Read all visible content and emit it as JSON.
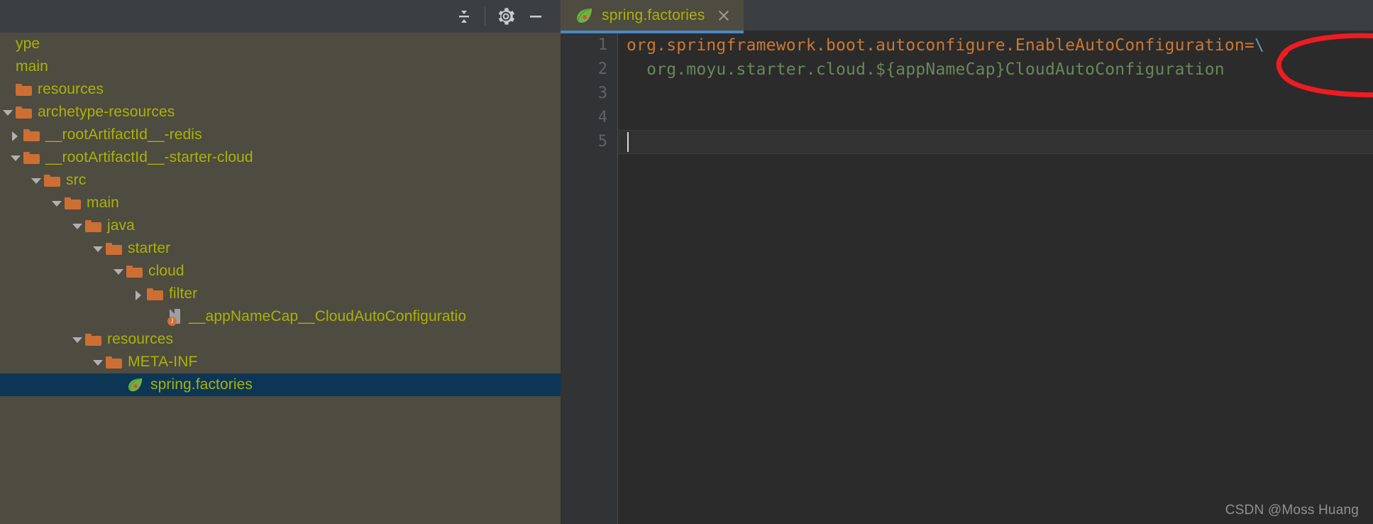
{
  "window": {
    "title_partial_text": "ype"
  },
  "tool_window": {
    "header": {
      "buttons": [
        {
          "name": "collapse-all",
          "label": "Collapse All",
          "icon": "collapse-all-icon"
        },
        {
          "name": "settings",
          "label": "Settings",
          "icon": "gear-icon"
        },
        {
          "name": "hide",
          "label": "Hide",
          "icon": "minimize-icon"
        }
      ]
    },
    "tree": {
      "cut_off_label": "ype",
      "items": [
        {
          "label": "ype",
          "indent": 0,
          "arrow": "none",
          "icon": "none",
          "selected": false
        },
        {
          "label": "main",
          "indent": 0,
          "arrow": "none",
          "icon": "none",
          "selected": false
        },
        {
          "label": "resources",
          "indent": 0,
          "arrow": "none",
          "icon": "folder",
          "selected": false
        },
        {
          "label": "archetype-resources",
          "indent": 0,
          "arrow": "down",
          "icon": "folder",
          "selected": false
        },
        {
          "label": "__rootArtifactId__-redis",
          "indent": 1,
          "arrow": "right",
          "icon": "folder",
          "selected": false
        },
        {
          "label": "__rootArtifactId__-starter-cloud",
          "indent": 1,
          "arrow": "down",
          "icon": "folder",
          "selected": false
        },
        {
          "label": "src",
          "indent": 2,
          "arrow": "down",
          "icon": "folder",
          "selected": false
        },
        {
          "label": "main",
          "indent": 3,
          "arrow": "down",
          "icon": "folder",
          "selected": false
        },
        {
          "label": "java",
          "indent": 4,
          "arrow": "down",
          "icon": "folder",
          "selected": false
        },
        {
          "label": "starter",
          "indent": 5,
          "arrow": "down",
          "icon": "folder",
          "selected": false
        },
        {
          "label": "cloud",
          "indent": 6,
          "arrow": "down",
          "icon": "folder",
          "selected": false
        },
        {
          "label": "filter",
          "indent": 7,
          "arrow": "right",
          "icon": "folder",
          "selected": false
        },
        {
          "label": "__appNameCap__CloudAutoConfiguratio",
          "indent": 8,
          "arrow": "none",
          "icon": "java",
          "selected": false
        },
        {
          "label": "resources",
          "indent": 4,
          "arrow": "down",
          "icon": "folder",
          "selected": false
        },
        {
          "label": "META-INF",
          "indent": 5,
          "arrow": "down",
          "icon": "folder",
          "selected": false
        },
        {
          "label": "spring.factories",
          "indent": 6,
          "arrow": "none",
          "icon": "spring",
          "selected": true
        }
      ]
    }
  },
  "editor": {
    "tabs": [
      {
        "label": "spring.factories",
        "icon": "spring-leaf-icon",
        "active": true,
        "close_label": "Close"
      }
    ],
    "gutter": {
      "line_numbers": [
        "1",
        "2",
        "3",
        "4",
        "5"
      ]
    },
    "lines": [
      {
        "number": "1",
        "tokens": [
          {
            "text": "org.springframework.boot.autoconfigure.EnableAutoConfiguration=",
            "type": "key"
          },
          {
            "text": "\\",
            "type": "esc"
          }
        ]
      },
      {
        "number": "2",
        "tokens": [
          {
            "text": "  org.moyu.starter.cloud.${appNameCap}CloudAutoConfiguration",
            "type": "val"
          }
        ]
      },
      {
        "number": "3",
        "tokens": []
      },
      {
        "number": "4",
        "tokens": []
      },
      {
        "number": "5",
        "tokens": []
      }
    ],
    "current_line": "5",
    "caret_visible": true
  },
  "annotation": {
    "shape": "ellipse",
    "color": "#ee1c22",
    "encircles": "autoconfigure.EnableAutoConfiguration / ${appNameCap}Cloud"
  },
  "watermark": {
    "text": "CSDN @Moss Huang"
  },
  "colors": {
    "sidebar_bg": "#4e4b40",
    "header_bg": "#3c3f41",
    "editor_bg": "#2b2b2b",
    "gutter_bg": "#313335",
    "tree_text": "#a9b307",
    "folder": "#cd6e33",
    "selection": "#0d3655",
    "tab_underline": "#4a88c7",
    "code_key": "#cc7832",
    "code_value": "#6a8759",
    "code_escape": "#6897bb",
    "annotation_red": "#ee1c22"
  }
}
